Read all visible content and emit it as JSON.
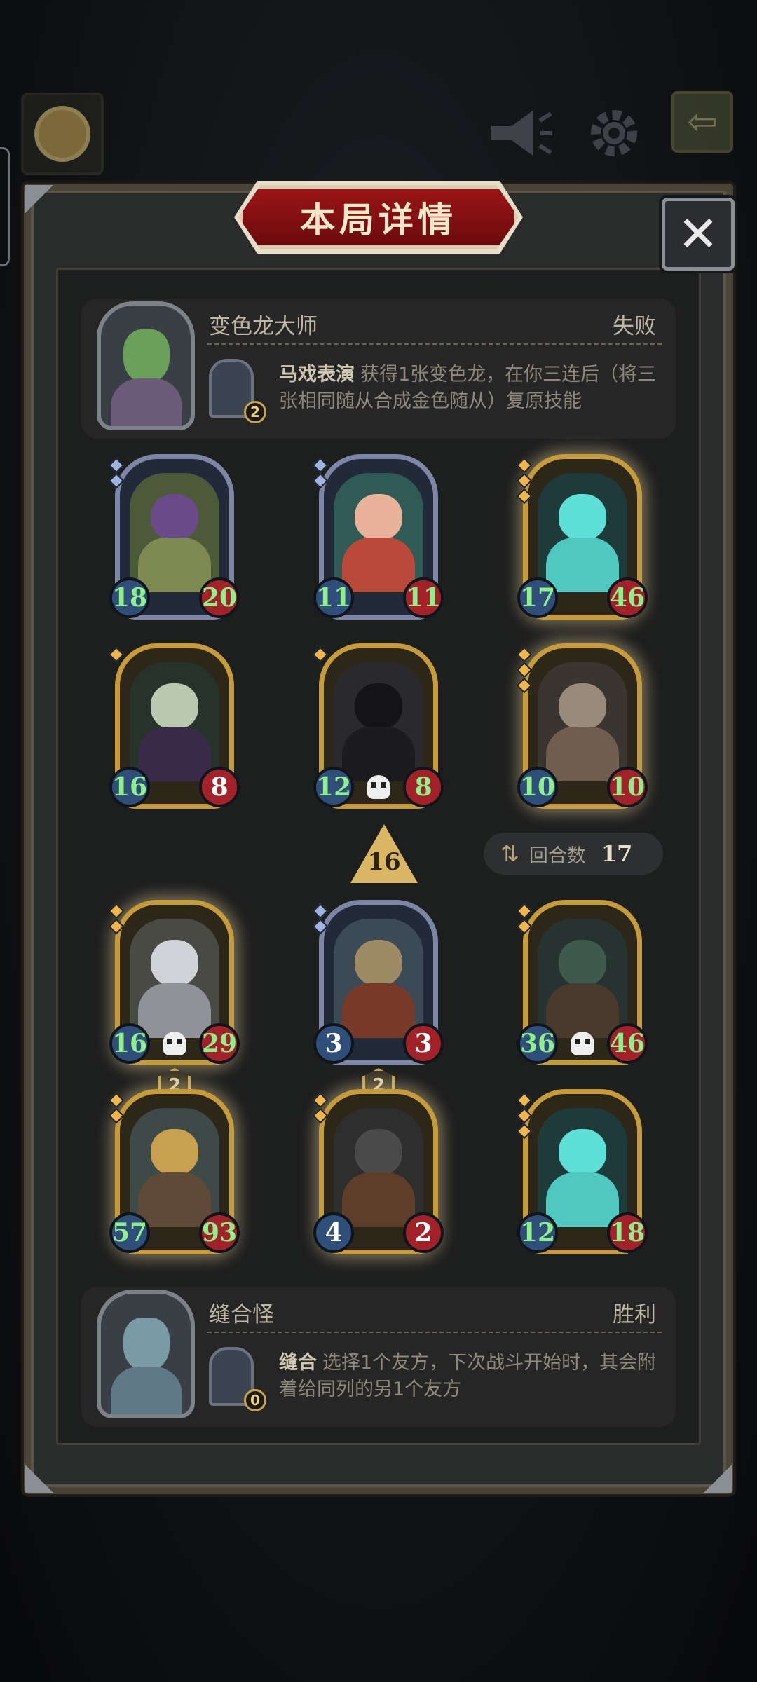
{
  "header": {
    "icons": [
      "avatar",
      "megaphone-icon",
      "gear-icon",
      "back-arrow-icon"
    ]
  },
  "dialog": {
    "title": "本局详情",
    "close_icon": "close-icon",
    "opponent": {
      "name": "变色龙大师",
      "result": "失败",
      "skill_name": "马戏表演",
      "skill_desc": "获得1张变色龙，在你三连后（将三张相同随从合成金色随从）复原技能",
      "skill_count": "2"
    },
    "player": {
      "name": "缝合怪",
      "result": "胜利",
      "skill_name": "缝合",
      "skill_desc": "选择1个友方，下次战斗开始时，其会附着给同列的另1个友方",
      "skill_count": "0"
    },
    "opponent_board": [
      {
        "atk": "18",
        "hp": "20",
        "tier": "silver",
        "buffed": true
      },
      {
        "atk": "11",
        "hp": "11",
        "tier": "silver",
        "buffed": true
      },
      {
        "atk": "17",
        "hp": "46",
        "tier": "gold",
        "buffed": true
      },
      {
        "atk": "16",
        "hp": "8",
        "tier": "gold",
        "buffed": true
      },
      {
        "atk": "12",
        "hp": "8",
        "tier": "gold",
        "buffed": true
      },
      {
        "atk": "10",
        "hp": "10",
        "tier": "gold",
        "buffed": true
      }
    ],
    "player_board": [
      {
        "atk": "16",
        "hp": "29",
        "tier": "gold",
        "buffed": true
      },
      {
        "atk": "3",
        "hp": "3",
        "tier": "silver",
        "buffed": false
      },
      {
        "atk": "36",
        "hp": "46",
        "tier": "gold",
        "buffed": true
      },
      {
        "atk": "57",
        "hp": "93",
        "tier": "gold",
        "buffed": true,
        "level": "2"
      },
      {
        "atk": "4",
        "hp": "2",
        "tier": "gold",
        "buffed": false,
        "level": "2"
      },
      {
        "atk": "12",
        "hp": "18",
        "tier": "gold",
        "buffed": true
      }
    ],
    "damage": "16",
    "round_label": "回合数",
    "round_value": "17"
  }
}
